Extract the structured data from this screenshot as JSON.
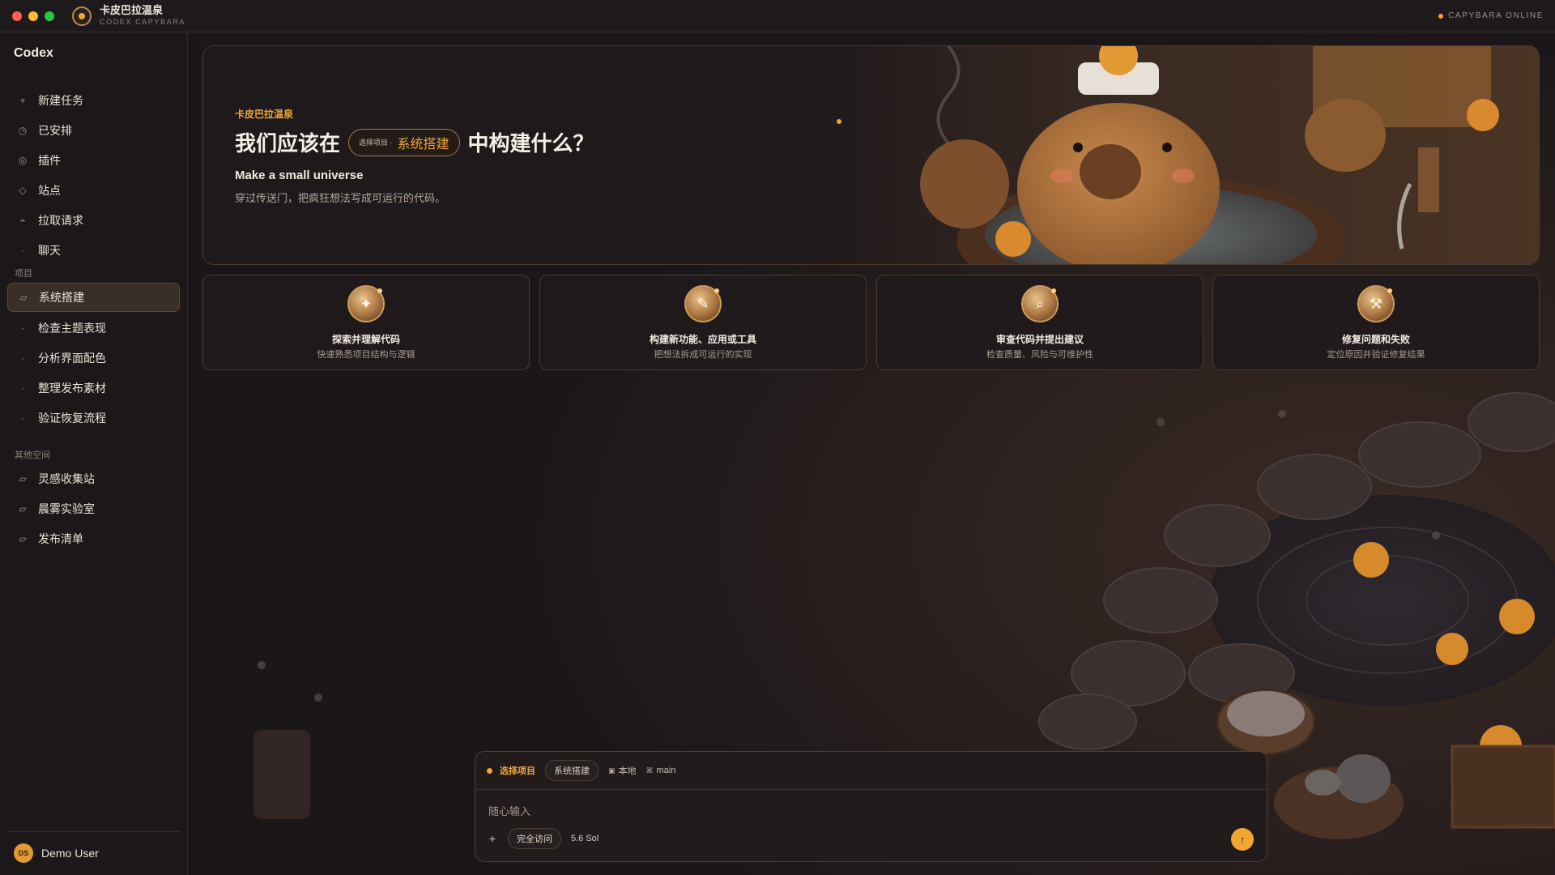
{
  "window": {
    "app_title": "卡皮巴拉温泉",
    "app_subtitle": "CODEX CAPYBARA",
    "status_text": "CAPYBARA ONLINE"
  },
  "sidebar": {
    "title": "Codex",
    "nav_items": [
      {
        "label": "新建任务",
        "icon": "plus-icon",
        "glyph": "+"
      },
      {
        "label": "已安排",
        "icon": "clock-icon",
        "glyph": "◷"
      },
      {
        "label": "插件",
        "icon": "plugin-icon",
        "glyph": "◎"
      },
      {
        "label": "站点",
        "icon": "diamond-icon",
        "glyph": "◇"
      },
      {
        "label": "拉取请求",
        "icon": "pull-request-icon",
        "glyph": "⌁"
      },
      {
        "label": "聊天",
        "icon": "chat-icon",
        "glyph": "·"
      }
    ],
    "projects_label": "项目",
    "projects": [
      {
        "label": "系统搭建",
        "icon": "folder-icon",
        "glyph": "▱",
        "active": true
      },
      {
        "label": "检查主题表现",
        "glyph": "·"
      },
      {
        "label": "分析界面配色",
        "glyph": "·"
      },
      {
        "label": "整理发布素材",
        "glyph": "·"
      },
      {
        "label": "验证恢复流程",
        "glyph": "·"
      }
    ],
    "other_label": "其他空间",
    "other_spaces": [
      {
        "label": "灵感收集站",
        "icon": "folder-icon",
        "glyph": "▱"
      },
      {
        "label": "晨雾实验室",
        "icon": "folder-icon",
        "glyph": "▱"
      },
      {
        "label": "发布清单",
        "icon": "folder-icon",
        "glyph": "▱"
      }
    ],
    "user": {
      "initials": "DS",
      "name": "Demo User"
    }
  },
  "hero": {
    "eyebrow": "卡皮巴拉温泉",
    "heading_before": "我们应该在",
    "pill_label": "选择项目 ·",
    "pill_value": "系统搭建",
    "heading_after": "中构建什么？",
    "subtitle": "Make a small universe",
    "description": "穿过传送门，把疯狂想法写成可运行的代码。"
  },
  "cards": [
    {
      "title": "探索并理解代码",
      "desc": "快速熟悉项目结构与逻辑",
      "icon": "sparkle-icon",
      "glyph": "✦"
    },
    {
      "title": "构建新功能、应用或工具",
      "desc": "把想法拆成可运行的实现",
      "icon": "pencil-icon",
      "glyph": "✎"
    },
    {
      "title": "审查代码并提出建议",
      "desc": "检查质量、风险与可维护性",
      "icon": "magnifier-icon",
      "glyph": "⌕"
    },
    {
      "title": "修复问题和失败",
      "desc": "定位原因并验证修复结果",
      "icon": "wrench-icon",
      "glyph": "⚒"
    }
  ],
  "composer": {
    "select_label": "选择项目",
    "project_chip": "系统搭建",
    "env_icon": "▣",
    "env_label": "本地",
    "branch_icon": "⌘",
    "branch_label": "main",
    "placeholder": "随心输入",
    "plus": "+",
    "access_label": "完全访问",
    "model_label": "5.6 Sol",
    "send_glyph": "↑"
  },
  "colors": {
    "accent": "#f2a531",
    "background": "#1b1719",
    "panel_border": "#4a3a31"
  }
}
